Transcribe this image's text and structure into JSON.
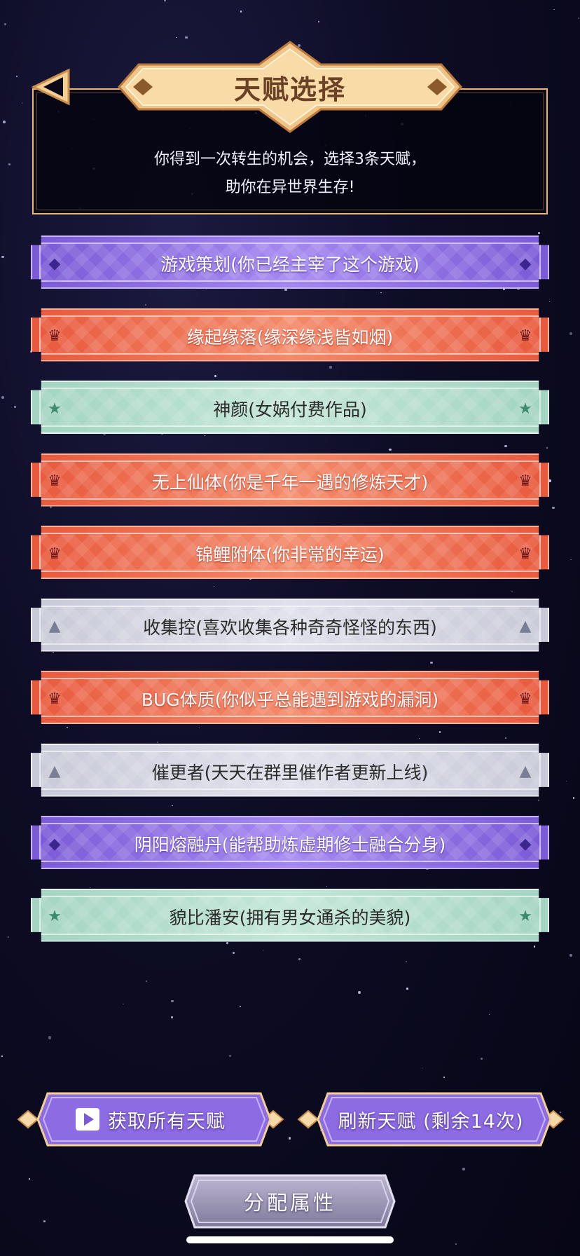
{
  "header": {
    "title": "天赋选择",
    "description_line1": "你得到一次转生的机会，选择3条天赋，",
    "description_line2": "助你在异世界生存!"
  },
  "talents": [
    {
      "label": "游戏策划(你已经主宰了这个游戏)",
      "rarity": "purple",
      "icon": "gem-icon"
    },
    {
      "label": "缘起缘落(缘深缘浅皆如烟)",
      "rarity": "orange",
      "icon": "crown-icon"
    },
    {
      "label": "神颜(女娲付费作品)",
      "rarity": "green",
      "icon": "star-icon"
    },
    {
      "label": "无上仙体(你是千年一遇的修炼天才)",
      "rarity": "orange",
      "icon": "crown-icon"
    },
    {
      "label": "锦鲤附体(你非常的幸运)",
      "rarity": "orange",
      "icon": "crown-icon"
    },
    {
      "label": "收集控(喜欢收集各种奇奇怪怪的东西)",
      "rarity": "gray",
      "icon": "triangle-icon"
    },
    {
      "label": "BUG体质(你似乎总能遇到游戏的漏洞)",
      "rarity": "orange",
      "icon": "crown-icon"
    },
    {
      "label": "催更者(天天在群里催作者更新上线)",
      "rarity": "gray",
      "icon": "triangle-icon"
    },
    {
      "label": "阴阳熔融丹(能帮助炼虚期修士融合分身)",
      "rarity": "purple",
      "icon": "gem-icon"
    },
    {
      "label": "貌比潘安(拥有男女通杀的美貌)",
      "rarity": "green",
      "icon": "star-icon"
    }
  ],
  "buttons": {
    "get_all": "获取所有天赋",
    "refresh": "刷新天赋 (剩余14次)",
    "allocate": "分配属性"
  },
  "colors": {
    "gold_border": "#e6b77a",
    "purple": "#8a6ae0",
    "orange": "#ec6a4b",
    "green": "#b3dccd",
    "gray": "#d3d4e0"
  }
}
